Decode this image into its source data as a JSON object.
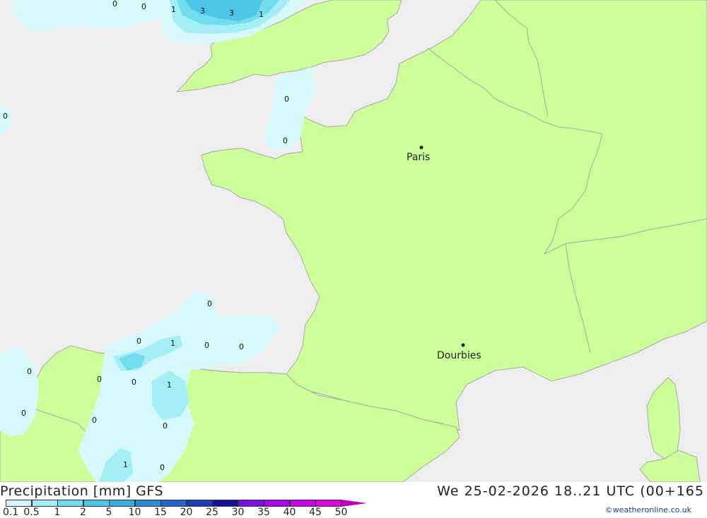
{
  "title": "Precipitation [mm] GFS",
  "datetime": "We 25-02-2026 18..21 UTC (00+165",
  "credit": "©weatheronline.co.uk",
  "colors": {
    "sea": "#ededed",
    "land": "#ccff99",
    "border": "#a8a8a8",
    "p01": "#d6f8fa",
    "p05": "#a4eef5",
    "p1": "#70dcee",
    "p2": "#4ec6e8",
    "city": "#222222"
  },
  "cities": [
    {
      "name": "Paris"
    },
    {
      "name": "Dourbies"
    }
  ],
  "precip_labels": [
    "0",
    "0",
    "1",
    "3",
    "3",
    "1",
    "0",
    "0",
    "0",
    "0",
    "0",
    "1",
    "0",
    "0",
    "0",
    "0",
    "0",
    "1",
    "0",
    "0",
    "0",
    "1",
    "0"
  ],
  "legend": {
    "ticks": [
      "0.1",
      "0.5",
      "1",
      "2",
      "5",
      "10",
      "15",
      "20",
      "25",
      "30",
      "35",
      "40",
      "45",
      "50"
    ],
    "colors": [
      "#d6f8fa",
      "#a4eef5",
      "#70dcee",
      "#4ec6e8",
      "#38aee0",
      "#2c8ad8",
      "#2264cc",
      "#1a3cb8",
      "#10149a",
      "#7a10e6",
      "#a800f0",
      "#cc00e8",
      "#e600e0",
      "#c000b8"
    ]
  }
}
